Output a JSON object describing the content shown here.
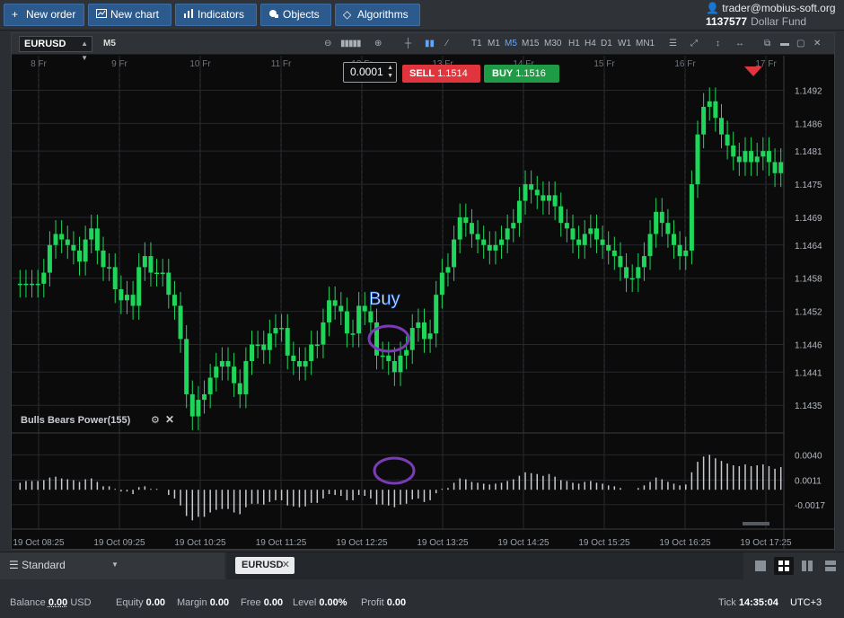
{
  "toolbar": {
    "buttons": [
      {
        "label": "New order",
        "icon": "plus-icon"
      },
      {
        "label": "New chart",
        "icon": "chart-icon"
      },
      {
        "label": "Indicators",
        "icon": "bars-icon"
      },
      {
        "label": "Objects",
        "icon": "objects-icon"
      },
      {
        "label": "Algorithms",
        "icon": "diamond-icon"
      }
    ]
  },
  "account": {
    "user": "trader@mobius-soft.org",
    "number": "1137577",
    "fund": "Dollar Fund"
  },
  "chart_window": {
    "symbol": "EURUSD",
    "timeframe": "M5",
    "timeframes": [
      "T1",
      "M1",
      "M5",
      "M15",
      "M30",
      "H1",
      "H4",
      "D1",
      "W1",
      "MN1"
    ],
    "active_timeframe": "M5"
  },
  "trade": {
    "lot": "0.0001",
    "sell_label": "SELL",
    "sell_price": "1.1514",
    "buy_label": "BUY",
    "buy_price": "1.1516"
  },
  "annotation": {
    "text": "Buy",
    "color": "#7a3cb5"
  },
  "indicator": {
    "name": "Bulls Bears Power(155)"
  },
  "colors": {
    "bull": "#1fd65a",
    "bear": "#1fd65a",
    "accent": "#2d5a8c",
    "sell": "#e0353d",
    "buy": "#1f9a45"
  },
  "chart_data": {
    "type": "candlestick",
    "top_axis_dates": [
      "8 Fr",
      "9 Fr",
      "10 Fr",
      "11 Fr",
      "12 Fr",
      "13 Fr",
      "14 Fr",
      "15 Fr",
      "16 Fr",
      "17 Fr"
    ],
    "price_ticks": [
      "1.1492",
      "1.1486",
      "1.1481",
      "1.1475",
      "1.1469",
      "1.1464",
      "1.1458",
      "1.1452",
      "1.1446",
      "1.1441",
      "1.1435"
    ],
    "ylim": [
      1.143,
      1.1495
    ],
    "indicator_ticks": [
      "0.0040",
      "0.0011",
      "-0.0017"
    ],
    "indicator_ylim": [
      -0.0045,
      0.0065
    ],
    "x_labels": [
      "19 Oct 08:25",
      "19 Oct 09:25",
      "19 Oct 10:25",
      "19 Oct 11:25",
      "19 Oct 12:25",
      "19 Oct 13:25",
      "19 Oct 14:25",
      "19 Oct 15:25",
      "19 Oct 16:25",
      "19 Oct 17:25"
    ],
    "close": [
      1.1457,
      1.1457,
      1.1457,
      1.1457,
      1.1459,
      1.1464,
      1.1466,
      1.1465,
      1.1464,
      1.1463,
      1.1461,
      1.1465,
      1.1467,
      1.1463,
      1.146,
      1.146,
      1.1456,
      1.1454,
      1.1455,
      1.1453,
      1.146,
      1.1462,
      1.1459,
      1.1459,
      1.1459,
      1.1455,
      1.1453,
      1.1447,
      1.1437,
      1.1433,
      1.1436,
      1.1437,
      1.144,
      1.1442,
      1.1443,
      1.1442,
      1.1439,
      1.1437,
      1.1443,
      1.1446,
      1.1446,
      1.1445,
      1.1448,
      1.1449,
      1.1449,
      1.1444,
      1.1443,
      1.1442,
      1.1443,
      1.1446,
      1.1446,
      1.145,
      1.1454,
      1.1453,
      1.1452,
      1.1448,
      1.1448,
      1.1453,
      1.1452,
      1.145,
      1.1444,
      1.1444,
      1.1443,
      1.1441,
      1.1444,
      1.1445,
      1.1449,
      1.145,
      1.1447,
      1.1448,
      1.1455,
      1.1459,
      1.146,
      1.1465,
      1.1469,
      1.1468,
      1.1466,
      1.1465,
      1.1464,
      1.1463,
      1.1464,
      1.1465,
      1.1467,
      1.1468,
      1.1472,
      1.1475,
      1.1474,
      1.1473,
      1.1472,
      1.1473,
      1.1471,
      1.1468,
      1.1467,
      1.1465,
      1.1464,
      1.1466,
      1.1467,
      1.1465,
      1.1464,
      1.1463,
      1.1462,
      1.146,
      1.1458,
      1.1458,
      1.146,
      1.1462,
      1.1466,
      1.147,
      1.1468,
      1.1466,
      1.1464,
      1.1462,
      1.1463,
      1.1475,
      1.1484,
      1.1489,
      1.149,
      1.1487,
      1.1484,
      1.1482,
      1.148,
      1.1479,
      1.1481,
      1.1479,
      1.148,
      1.1481,
      1.1479,
      1.1477,
      1.1479
    ],
    "indicator_values": [
      0.0008,
      0.001,
      0.001,
      0.001,
      0.0011,
      0.0014,
      0.0015,
      0.0013,
      0.0012,
      0.0011,
      0.0009,
      0.0012,
      0.0013,
      0.0009,
      0.0004,
      0.0004,
      0.0001,
      -0.0002,
      -0.0002,
      -0.0005,
      0.0003,
      0.0004,
      0.0001,
      0.0001,
      0.0,
      -0.0006,
      -0.001,
      -0.0018,
      -0.003,
      -0.0035,
      -0.0031,
      -0.0031,
      -0.0026,
      -0.0023,
      -0.0022,
      -0.0022,
      -0.0026,
      -0.0028,
      -0.002,
      -0.0016,
      -0.0016,
      -0.0017,
      -0.0014,
      -0.0012,
      -0.0012,
      -0.0018,
      -0.0019,
      -0.002,
      -0.0019,
      -0.0015,
      -0.0015,
      -0.001,
      -0.0005,
      -0.0006,
      -0.0007,
      -0.0012,
      -0.0012,
      -0.0006,
      -0.0007,
      -0.001,
      -0.0017,
      -0.0017,
      -0.0018,
      -0.002,
      -0.0017,
      -0.0016,
      -0.0011,
      -0.001,
      -0.0014,
      -0.0012,
      -0.0004,
      0.0001,
      0.0002,
      0.0008,
      0.0013,
      0.0012,
      0.0009,
      0.0008,
      0.0007,
      0.0006,
      0.0007,
      0.0008,
      0.001,
      0.0012,
      0.0016,
      0.002,
      0.0019,
      0.0018,
      0.0016,
      0.0018,
      0.0015,
      0.0011,
      0.001,
      0.0008,
      0.0007,
      0.0009,
      0.001,
      0.0008,
      0.0007,
      0.0005,
      0.0004,
      0.0002,
      0.0,
      0.0,
      0.0002,
      0.0005,
      0.0009,
      0.0014,
      0.0012,
      0.0009,
      0.0007,
      0.0005,
      0.0006,
      0.002,
      0.0032,
      0.0038,
      0.004,
      0.0036,
      0.0033,
      0.003,
      0.0028,
      0.0027,
      0.0029,
      0.0027,
      0.0028,
      0.0029,
      0.0027,
      0.0024,
      0.0026
    ]
  },
  "bottom": {
    "layout": "Standard",
    "tab": "EURUSD"
  },
  "statusbar": {
    "balance_label": "Balance",
    "balance": "0.00",
    "currency": "USD",
    "equity_label": "Equity",
    "equity": "0.00",
    "margin_label": "Margin",
    "margin": "0.00",
    "free_label": "Free",
    "free": "0.00",
    "level_label": "Level",
    "level": "0.00%",
    "profit_label": "Profit",
    "profit": "0.00",
    "tick_label": "Tick",
    "tick_time": "14:35:04",
    "timezone": "UTC+3"
  }
}
